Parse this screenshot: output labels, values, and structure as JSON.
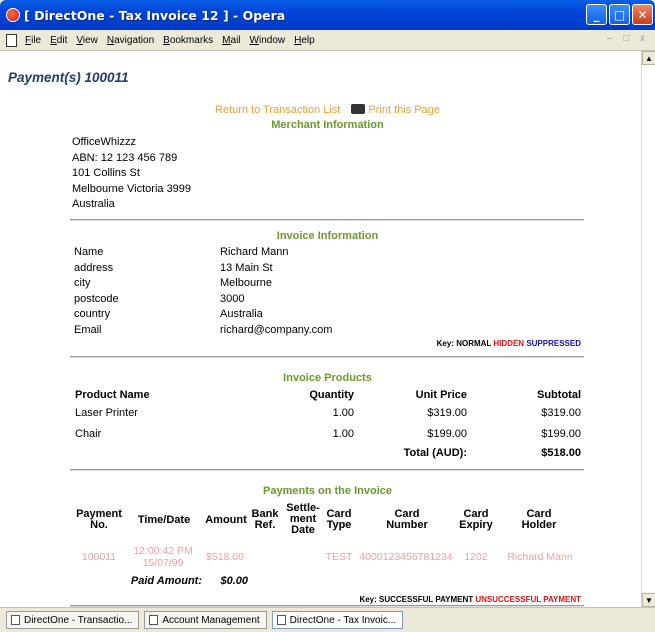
{
  "window": {
    "title": "[ DirectOne - Tax Invoice 12 ] - Opera"
  },
  "menu": [
    "File",
    "Edit",
    "View",
    "Navigation",
    "Bookmarks",
    "Mail",
    "Window",
    "Help"
  ],
  "page": {
    "title": "Payment(s) 100011",
    "return_link": "Return to Transaction List",
    "print_link": "Print this Page"
  },
  "merchant": {
    "heading": "Merchant Information",
    "lines": [
      "OfficeWhizzz",
      "ABN: 12 123 456 789",
      "101 Collins St",
      "Melbourne Victoria 3999",
      "Australia"
    ]
  },
  "invoice": {
    "heading": "Invoice Information",
    "fields": [
      {
        "label": "Name",
        "value": "Richard Mann"
      },
      {
        "label": "address",
        "value": "13 Main St"
      },
      {
        "label": "city",
        "value": "Melbourne"
      },
      {
        "label": "postcode",
        "value": "3000"
      },
      {
        "label": "country",
        "value": "Australia"
      },
      {
        "label": "Email",
        "value": "richard@company.com"
      }
    ],
    "key_label": "Key:",
    "key_normal": "NORMAL",
    "key_hidden": "HIDDEN",
    "key_suppressed": "SUPPRESSED"
  },
  "products": {
    "heading": "Invoice Products",
    "columns": [
      "Product Name",
      "Quantity",
      "Unit Price",
      "Subtotal"
    ],
    "rows": [
      {
        "name": "Laser Printer",
        "qty": "1.00",
        "unit": "$319.00",
        "subtotal": "$319.00"
      },
      {
        "name": "Chair",
        "qty": "1.00",
        "unit": "$199.00",
        "subtotal": "$199.00"
      }
    ],
    "total_label": "Total (AUD):",
    "total_value": "$518.00"
  },
  "payments": {
    "heading": "Payments on the Invoice",
    "columns": [
      "Payment No.",
      "Time/Date",
      "Amount",
      "Bank Ref.",
      "Settle-ment Date",
      "Card Type",
      "Card Number",
      "Card Expiry",
      "Card Holder"
    ],
    "row": {
      "no": "100011",
      "time": "12:00:42 PM",
      "date": "15/07/99",
      "amount": "$518.00",
      "bank_ref": "",
      "settlement": "",
      "card_type": "TEST",
      "card_number": "4000123456781234",
      "card_expiry": "1202",
      "card_holder": "Richard Mann"
    },
    "paid_label": "Paid Amount:",
    "paid_value": "$0.00",
    "key_label": "Key:",
    "key_success": "SUCCESSFUL PAYMENT",
    "key_unsuccess": "UNSUCCESSFUL PAYMENT"
  },
  "taskbar": [
    "DirectOne - Transactio...",
    "Account Management",
    "DirectOne - Tax Invoic..."
  ],
  "colors": {
    "accent_green": "#6b9a2c",
    "link_orange": "#f0a030",
    "hidden_red": "#e01010",
    "suppressed_blue": "#1010d0"
  }
}
